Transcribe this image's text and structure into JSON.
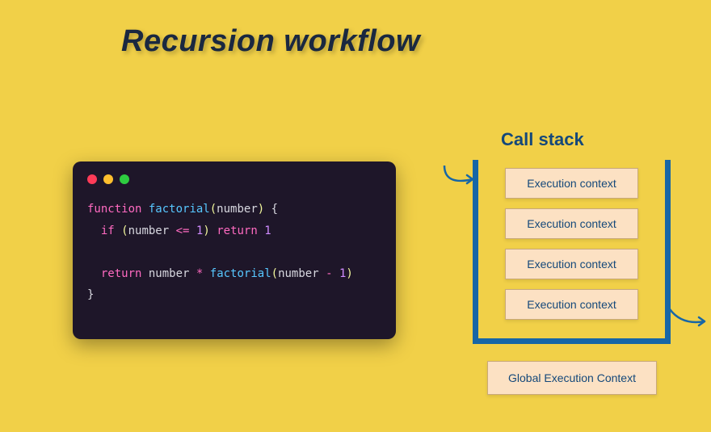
{
  "title": "Recursion workflow",
  "code": {
    "line1_kw": "function",
    "line1_fn": "factorial",
    "line1_param": "number",
    "line2_if": "if",
    "line2_cond_var": "number",
    "line2_cond_op": "<=",
    "line2_cond_val": "1",
    "line2_ret": "return",
    "line2_retval": "1",
    "line4_ret": "return",
    "line4_var": "number",
    "line4_op": "*",
    "line4_fn": "factorial",
    "line4_arg_var": "number",
    "line4_arg_op": "-",
    "line4_arg_val": "1"
  },
  "stack": {
    "title": "Call stack",
    "items": [
      "Execution context",
      "Execution context",
      "Execution context",
      "Execution context"
    ],
    "global": "Global Execution Context"
  }
}
